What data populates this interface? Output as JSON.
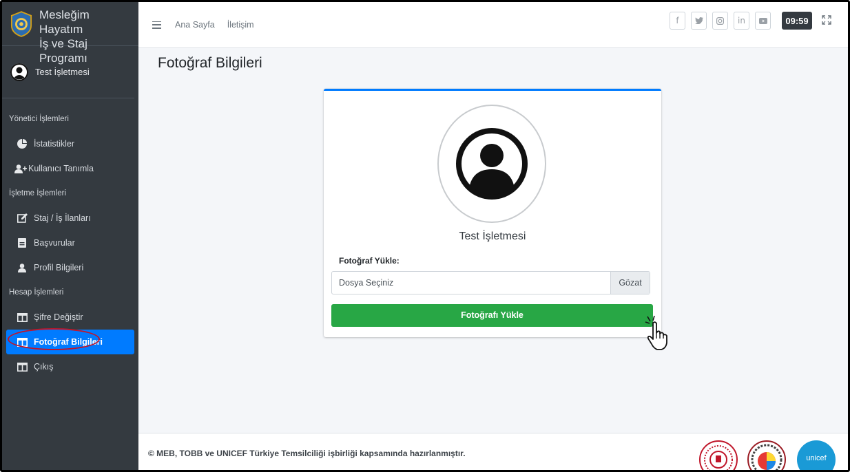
{
  "brand": {
    "line1": "Mesleğim Hayatım",
    "line2": "İş ve Staj Programı",
    "logo_icon": "gear-badge-icon"
  },
  "user": {
    "name": "Test İşletmesi",
    "avatar_icon": "user-circle-icon"
  },
  "sidebar": {
    "sections": [
      {
        "header": "Yönetici İşlemleri",
        "items": [
          {
            "label": "İstatistikler",
            "icon": "pie-chart-icon"
          },
          {
            "label": "Kullanıcı Tanımla",
            "icon": "user-plus-icon"
          }
        ]
      },
      {
        "header": "İşletme İşlemleri",
        "items": [
          {
            "label": "Staj / İş İlanları",
            "icon": "edit-icon"
          },
          {
            "label": "Başvurular",
            "icon": "document-icon"
          },
          {
            "label": "Profil Bilgileri",
            "icon": "user-icon"
          }
        ]
      },
      {
        "header": "Hesap İşlemleri",
        "items": [
          {
            "label": "Şifre Değiştir",
            "icon": "columns-icon"
          },
          {
            "label": "Fotoğraf Bilgileri",
            "icon": "columns-icon",
            "active": true
          },
          {
            "label": "Çıkış",
            "icon": "columns-icon"
          }
        ]
      }
    ]
  },
  "topbar": {
    "links": [
      "Ana Sayfa",
      "İletişim"
    ],
    "social": [
      {
        "name": "facebook-icon",
        "glyph": "f"
      },
      {
        "name": "twitter-icon",
        "glyph": "🐦"
      },
      {
        "name": "instagram-icon",
        "glyph": "◎"
      },
      {
        "name": "linkedin-icon",
        "glyph": "in"
      },
      {
        "name": "youtube-icon",
        "glyph": "▶"
      }
    ],
    "clock": "09:59"
  },
  "page": {
    "title": "Fotoğraf Bilgileri"
  },
  "card": {
    "name": "Test İşletmesi",
    "upload_label": "Fotoğraf Yükle:",
    "file_placeholder": "Dosya Seçiniz",
    "browse_label": "Gözat",
    "upload_button": "Fotoğrafı Yükle"
  },
  "footer": {
    "text": "© MEB, TOBB ve UNICEF Türkiye Temsilciliği işbirliği kapsamında hazırlanmıştır.",
    "unicef_logo_text": "unicef"
  },
  "colors": {
    "sidebar": "#343a40",
    "primary": "#007bff",
    "success": "#28a745",
    "highlight_ring": "#c0162a"
  }
}
